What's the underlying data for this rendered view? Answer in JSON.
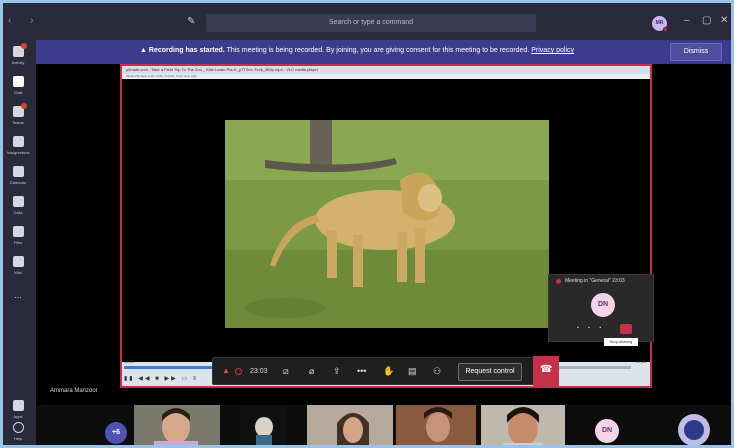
{
  "topbar": {
    "search_placeholder": "Search or type a command",
    "avatar_initials": "MR"
  },
  "rail": {
    "items": [
      {
        "label": "Activity"
      },
      {
        "label": "Chat"
      },
      {
        "label": "Teams"
      },
      {
        "label": "Assignments"
      },
      {
        "label": "Calendar"
      },
      {
        "label": "Calls"
      },
      {
        "label": "Files"
      },
      {
        "label": "Wiki"
      }
    ],
    "more_label": "...",
    "bottom": [
      {
        "label": "Apps"
      },
      {
        "label": "Help"
      }
    ]
  },
  "banner": {
    "strong": "Recording has started.",
    "text": " This meeting is being recorded. By joining, you are giving consent for this meeting to be recorded.",
    "link": "Privacy policy",
    "dismiss": "Dismiss"
  },
  "vlc": {
    "title": "y2mate.com - Take a Field Trip To The Zoo _ Kids Learn Pre-K_pTT2nn-Tv4k_360p.mp4 - VLC media player",
    "menu": "Media  Playback  Audio  Video  Subtitle  Tools  View  Help",
    "time_left": "06:03",
    "time_right": "07:26",
    "progress": 0.83
  },
  "meeting_popup": {
    "title": "Meeting in \"General\"",
    "timer": "23:03",
    "initials": "DN",
    "tooltip": "Stop sharing"
  },
  "controls": {
    "timer": "23:03",
    "request_control": "Request control"
  },
  "presenter_name": "Ammara Manzoor",
  "participants": {
    "overflow": "+6",
    "initials": "DN"
  },
  "colors": {
    "accent": "#4f52b2",
    "banner": "#3d3b8d",
    "danger": "#c4314b"
  }
}
